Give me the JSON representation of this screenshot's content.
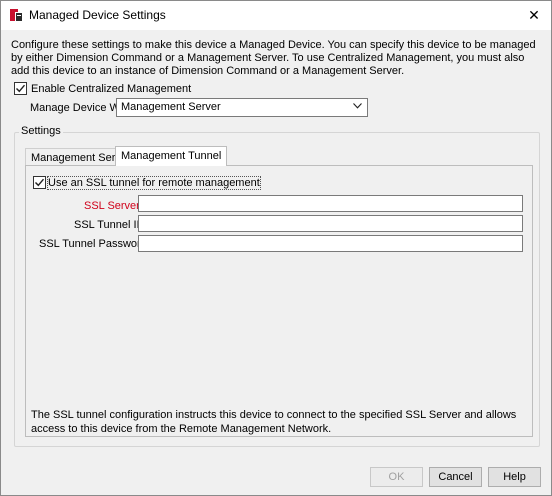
{
  "window": {
    "title": "Managed Device Settings",
    "close_glyph": "✕"
  },
  "intro": {
    "text": "Configure these settings to make this device a Managed Device. You can specify this device to be managed by either Dimension Command or a Management Server. To use Centralized Management, you must also add this device to an instance of Dimension Command or a Management Server."
  },
  "centralized": {
    "label": "Enable Centralized Management",
    "checked": true
  },
  "manage_with": {
    "label": "Manage Device With",
    "value": "Management Server"
  },
  "settings": {
    "group_label": "Settings",
    "tabs": [
      {
        "label": "Management Server",
        "active": false
      },
      {
        "label": "Management Tunnel",
        "active": true
      }
    ],
    "ssl_tunnel": {
      "label": "Use an SSL tunnel for remote management",
      "checked": true
    },
    "fields": {
      "server_label": "SSL Server:",
      "server_value": "",
      "tunnel_id_label": "SSL Tunnel ID:",
      "tunnel_id_value": "",
      "password_label": "SSL Tunnel Password:",
      "password_value": ""
    },
    "footnote": "The SSL tunnel configuration instructs this device to connect to the specified SSL Server and allows access to this device from the Remote Management Network."
  },
  "buttons": {
    "ok": "OK",
    "cancel": "Cancel",
    "help": "Help"
  },
  "colors": {
    "required_label": "#d0021b",
    "window_bg": "#f0f0f0"
  }
}
